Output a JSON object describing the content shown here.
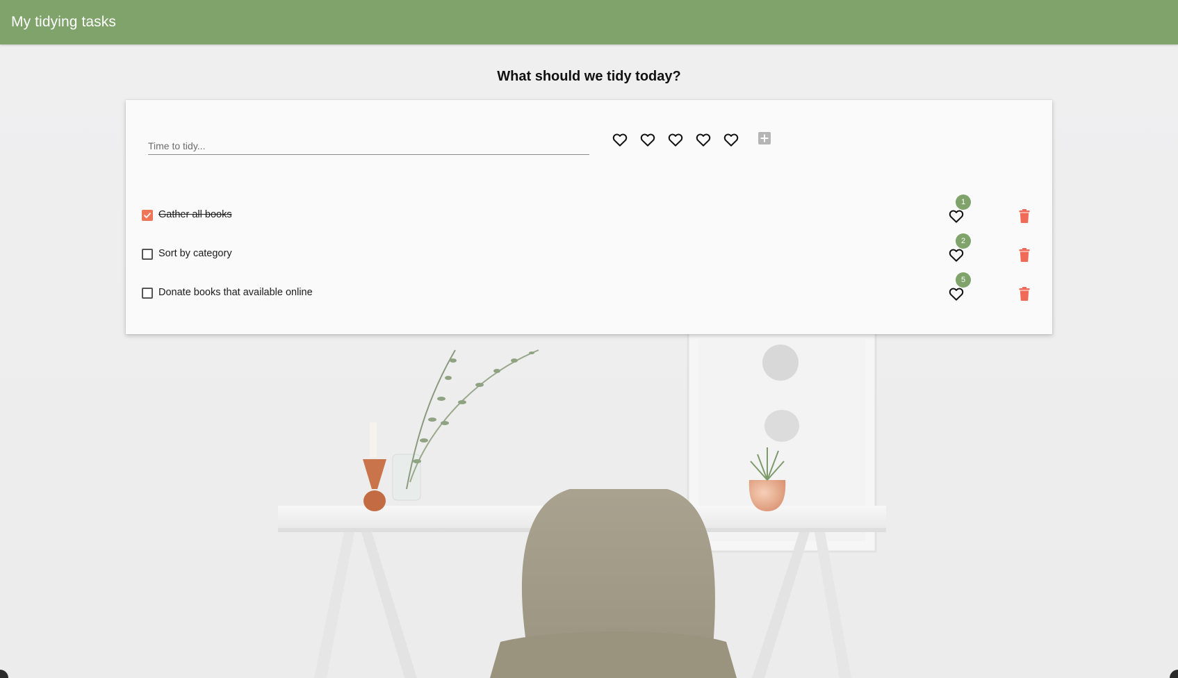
{
  "app": {
    "title": "My tidying tasks"
  },
  "heading": "What should we tidy today?",
  "new_task": {
    "placeholder": "Time to tidy...",
    "value": ""
  },
  "rating_selector": {
    "hearts": 5,
    "selected": 0,
    "icon": "heart-outline-icon"
  },
  "add_icon": "plus-square-icon",
  "colors": {
    "appbar": "#7fa36b",
    "badge": "#7fa36b",
    "accent": "#ef7558",
    "card": "#fafafa"
  },
  "tasks": [
    {
      "label": "Gather all books",
      "done": true,
      "rating": "1"
    },
    {
      "label": "Sort by category",
      "done": false,
      "rating": "2"
    },
    {
      "label": "Donate books that available online",
      "done": false,
      "rating": "5"
    }
  ]
}
